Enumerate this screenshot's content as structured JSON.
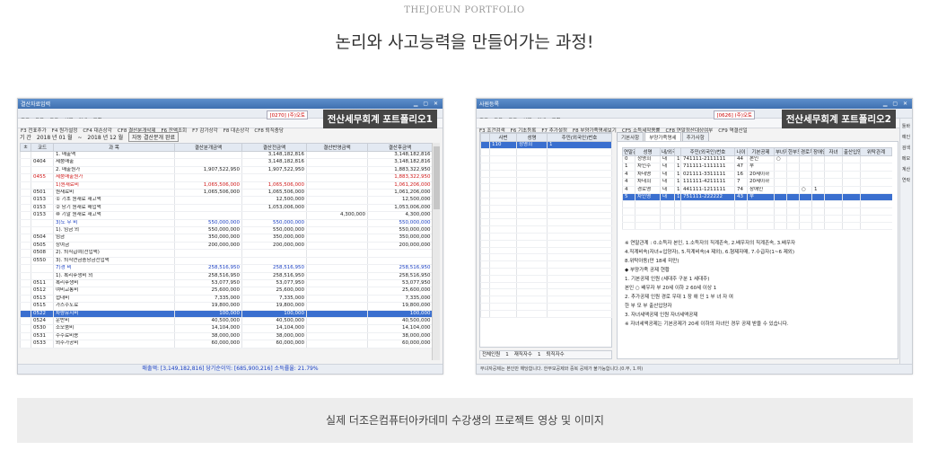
{
  "eyebrow": "THEJOEUN PORTFOLIO",
  "headline": "논리와 사고능력을 만들어가는 과정!",
  "caption": "실제 더조은컴퓨터아카데미 수강생의 프로젝트 영상 및 이미지",
  "shot1": {
    "title": "결산자료입력",
    "overlay": "전산세무회계 포트폴리오1",
    "code": "[0270] (주)오토",
    "toolbar": [
      "종료",
      "도움",
      "코드",
      "삭제",
      "인쇄",
      "조회"
    ],
    "fkeys": [
      "F3 전표추가",
      "F4 원가설정",
      "CF4 대손상각",
      "CF8 결산분개삭제",
      "F6 잔액조회",
      "F7 감가상각",
      "F8 대손상각",
      "CF8 퇴직충당"
    ],
    "period": {
      "label": "기 간",
      "from": "2018 년 01 월",
      "sep": "~",
      "to": "2018 년 12 월",
      "button": "자동 결산분개 완료"
    },
    "columns": [
      "±",
      "코드",
      "과 목",
      "결산분개금액",
      "결산전금액",
      "결산반영금액",
      "결산후금액"
    ],
    "rows": [
      {
        "code": "",
        "name": "1. 매출액",
        "a": "",
        "b": "3,148,182,816",
        "c": "",
        "d": "3,148,182,816",
        "style": ""
      },
      {
        "code": "0404",
        "name": "제품매출",
        "a": "",
        "b": "3,148,182,816",
        "c": "",
        "d": "3,148,182,816",
        "style": ""
      },
      {
        "code": "",
        "name": "2. 매출원가",
        "a": "1,907,522,950",
        "b": "1,907,522,950",
        "c": "",
        "d": "1,883,322,950",
        "style": ""
      },
      {
        "code": "0455",
        "name": "제품매출원가",
        "a": "",
        "b": "",
        "c": "",
        "d": "1,883,322,950",
        "style": "red"
      },
      {
        "code": "",
        "name": "1)원재료비",
        "a": "1,065,506,000",
        "b": "1,065,506,000",
        "c": "",
        "d": "1,061,206,000",
        "style": "red"
      },
      {
        "code": "0501",
        "name": "원재료비",
        "a": "1,065,506,000",
        "b": "1,065,506,000",
        "c": "",
        "d": "1,061,206,000",
        "style": ""
      },
      {
        "code": "0153",
        "name": "① 기초 원재료 재고액",
        "a": "",
        "b": "12,500,000",
        "c": "",
        "d": "12,500,000",
        "style": ""
      },
      {
        "code": "0153",
        "name": "② 당기 원재료 매입액",
        "a": "",
        "b": "1,053,006,000",
        "c": "",
        "d": "1,053,006,000",
        "style": ""
      },
      {
        "code": "0153",
        "name": "⑩ 기말 원재료 재고액",
        "a": "",
        "b": "",
        "c": "4,300,000",
        "d": "4,300,000",
        "style": ""
      },
      {
        "code": "",
        "name": "3)노 무 비",
        "a": "550,000,000",
        "b": "550,000,000",
        "c": "",
        "d": "550,000,000",
        "style": "blue"
      },
      {
        "code": "",
        "name": "1). 임금 외",
        "a": "550,000,000",
        "b": "550,000,000",
        "c": "",
        "d": "550,000,000",
        "style": ""
      },
      {
        "code": "0504",
        "name": "임금",
        "a": "350,000,000",
        "b": "350,000,000",
        "c": "",
        "d": "350,000,000",
        "style": ""
      },
      {
        "code": "0505",
        "name": "상여금",
        "a": "200,000,000",
        "b": "200,000,000",
        "c": "",
        "d": "200,000,000",
        "style": ""
      },
      {
        "code": "0508",
        "name": "2). 퇴직급여(전입액)",
        "a": "",
        "b": "",
        "c": "",
        "d": "",
        "style": ""
      },
      {
        "code": "0550",
        "name": "3). 퇴직연금충당금전입액",
        "a": "",
        "b": "",
        "c": "",
        "d": "",
        "style": ""
      },
      {
        "code": "",
        "name": "7)경 비",
        "a": "258,516,950",
        "b": "258,516,950",
        "c": "",
        "d": "258,516,950",
        "style": "blue"
      },
      {
        "code": "",
        "name": "1). 복리후생비 외",
        "a": "258,516,950",
        "b": "258,516,950",
        "c": "",
        "d": "258,516,950",
        "style": ""
      },
      {
        "code": "0511",
        "name": "복리후생비",
        "a": "53,077,950",
        "b": "53,077,950",
        "c": "",
        "d": "53,077,950",
        "style": ""
      },
      {
        "code": "0512",
        "name": "여비교통비",
        "a": "25,600,000",
        "b": "25,600,000",
        "c": "",
        "d": "25,600,000",
        "style": ""
      },
      {
        "code": "0513",
        "name": "접대비",
        "a": "7,335,000",
        "b": "7,335,000",
        "c": "",
        "d": "7,335,000",
        "style": ""
      },
      {
        "code": "0515",
        "name": "가스수도료",
        "a": "19,800,000",
        "b": "19,800,000",
        "c": "",
        "d": "19,800,000",
        "style": ""
      },
      {
        "code": "0522",
        "name": "차량유지비",
        "a": "100,000",
        "b": "100,000",
        "c": "",
        "d": "100,000",
        "style": "sel"
      },
      {
        "code": "0524",
        "name": "운반비",
        "a": "40,500,000",
        "b": "40,500,000",
        "c": "",
        "d": "40,500,000",
        "style": ""
      },
      {
        "code": "0530",
        "name": "소모품비",
        "a": "14,104,000",
        "b": "14,104,000",
        "c": "",
        "d": "14,104,000",
        "style": ""
      },
      {
        "code": "0531",
        "name": "수수료비용",
        "a": "38,000,000",
        "b": "38,000,000",
        "c": "",
        "d": "38,000,000",
        "style": ""
      },
      {
        "code": "0533",
        "name": "외주가공비",
        "a": "60,000,000",
        "b": "60,000,000",
        "c": "",
        "d": "60,000,000",
        "style": ""
      }
    ],
    "status": "매출액: [3,149,182,816] 당기순이익: [685,900,216] 소득률율: 21.79%"
  },
  "shot2": {
    "title": "사원등록",
    "overlay": "전산세무회계 포트폴리오2",
    "code": "[0626] (주)오토",
    "toolbar": [
      "종료",
      "도움",
      "코드",
      "삭제",
      "인쇄",
      "조회"
    ],
    "fkeys": [
      "F3 조건검색",
      "F6 기초등록",
      "F7 추가설정",
      "F8 부양가족명세보기",
      "CF5 소득세작용률",
      "CF8 연말정산대상여부",
      "CF9 역결산일"
    ],
    "emp_columns": [
      "",
      "사번",
      "성명",
      "주민(외국인)번호"
    ],
    "emp_rows": [
      [
        "110",
        "정영희",
        "1",
        "741111-2111111"
      ]
    ],
    "emp_footer": [
      "전체인원",
      "1",
      "재직자수",
      "1",
      "퇴직자수"
    ],
    "tabs": [
      "기본사항",
      "부양가족명세",
      "추가사항"
    ],
    "fam_columns": [
      "연말관계",
      "성명",
      "내/외국인",
      "",
      "주민(외국인)번호",
      "나이",
      "기본공제",
      "부녀자",
      "한부모",
      "경로우대",
      "장애인",
      "자녀",
      "출산입양",
      "위탁관계"
    ],
    "fam_rows": [
      [
        "0",
        "정영희",
        "내",
        "1",
        "741111-2111111",
        "44",
        "본인",
        "○",
        "",
        "",
        "",
        "",
        "",
        ""
      ],
      [
        "1",
        "차인수",
        "내",
        "1",
        "711111-1111111",
        "47",
        "부",
        "",
        "",
        "",
        "",
        "",
        "",
        ""
      ],
      [
        "4",
        "차네영",
        "내",
        "1",
        "021111-3311111",
        "16",
        "20세이하",
        "",
        "",
        "",
        "",
        "",
        "",
        ""
      ],
      [
        "4",
        "차네희",
        "내",
        "1",
        "111111-4211111",
        "7",
        "20세이하",
        "",
        "",
        "",
        "",
        "",
        "",
        ""
      ],
      [
        "4",
        "경로영",
        "내",
        "1",
        "441111-1211111",
        "74",
        "장애인",
        "",
        "",
        "○",
        "1",
        "",
        "",
        ""
      ],
      [
        "5",
        "차인영",
        "내",
        "1",
        "751111-222222",
        "43",
        "부",
        "",
        "",
        "",
        "",
        "",
        "",
        ""
      ]
    ],
    "notes": [
      "※ 연말관계 : 0.소득자 본인, 1.소득자의 직계존속, 2.배우자의 직계존속, 3.배우자",
      "4.직계비속(자녀+입양자), 5.직계비속(4 제외), 6.형제자매, 7.수급자(1~6 제외)",
      "8.위탁아동(만 18세 미만)",
      "◆ 부양가족 공제 현황",
      "1. 기본공제 인원 (세대주 구분 1 세대주)",
      "본인 ○ 배우자 부 20세 이하 2 60세 이상 1",
      "2. 추가공제 인원 경로 우대 1 장 애 인 1 부 녀 자 여",
      "한 부 모 부 출산입양자",
      "3. 자녀세액공제 인원 자녀세액공제",
      "※ 자녀세액공제는 기본공제가 20세 이하의 자녀인 경우 공제 받을 수 있습니다."
    ],
    "hint": "부녀자공제는 본인만 해당합니다. 한부모공제와 중복 공제가 불가능합니다.(0.부, 1.여)",
    "sidebar": [
      "툴바",
      "예인",
      "검색",
      "메모",
      "계산",
      "연락"
    ]
  }
}
